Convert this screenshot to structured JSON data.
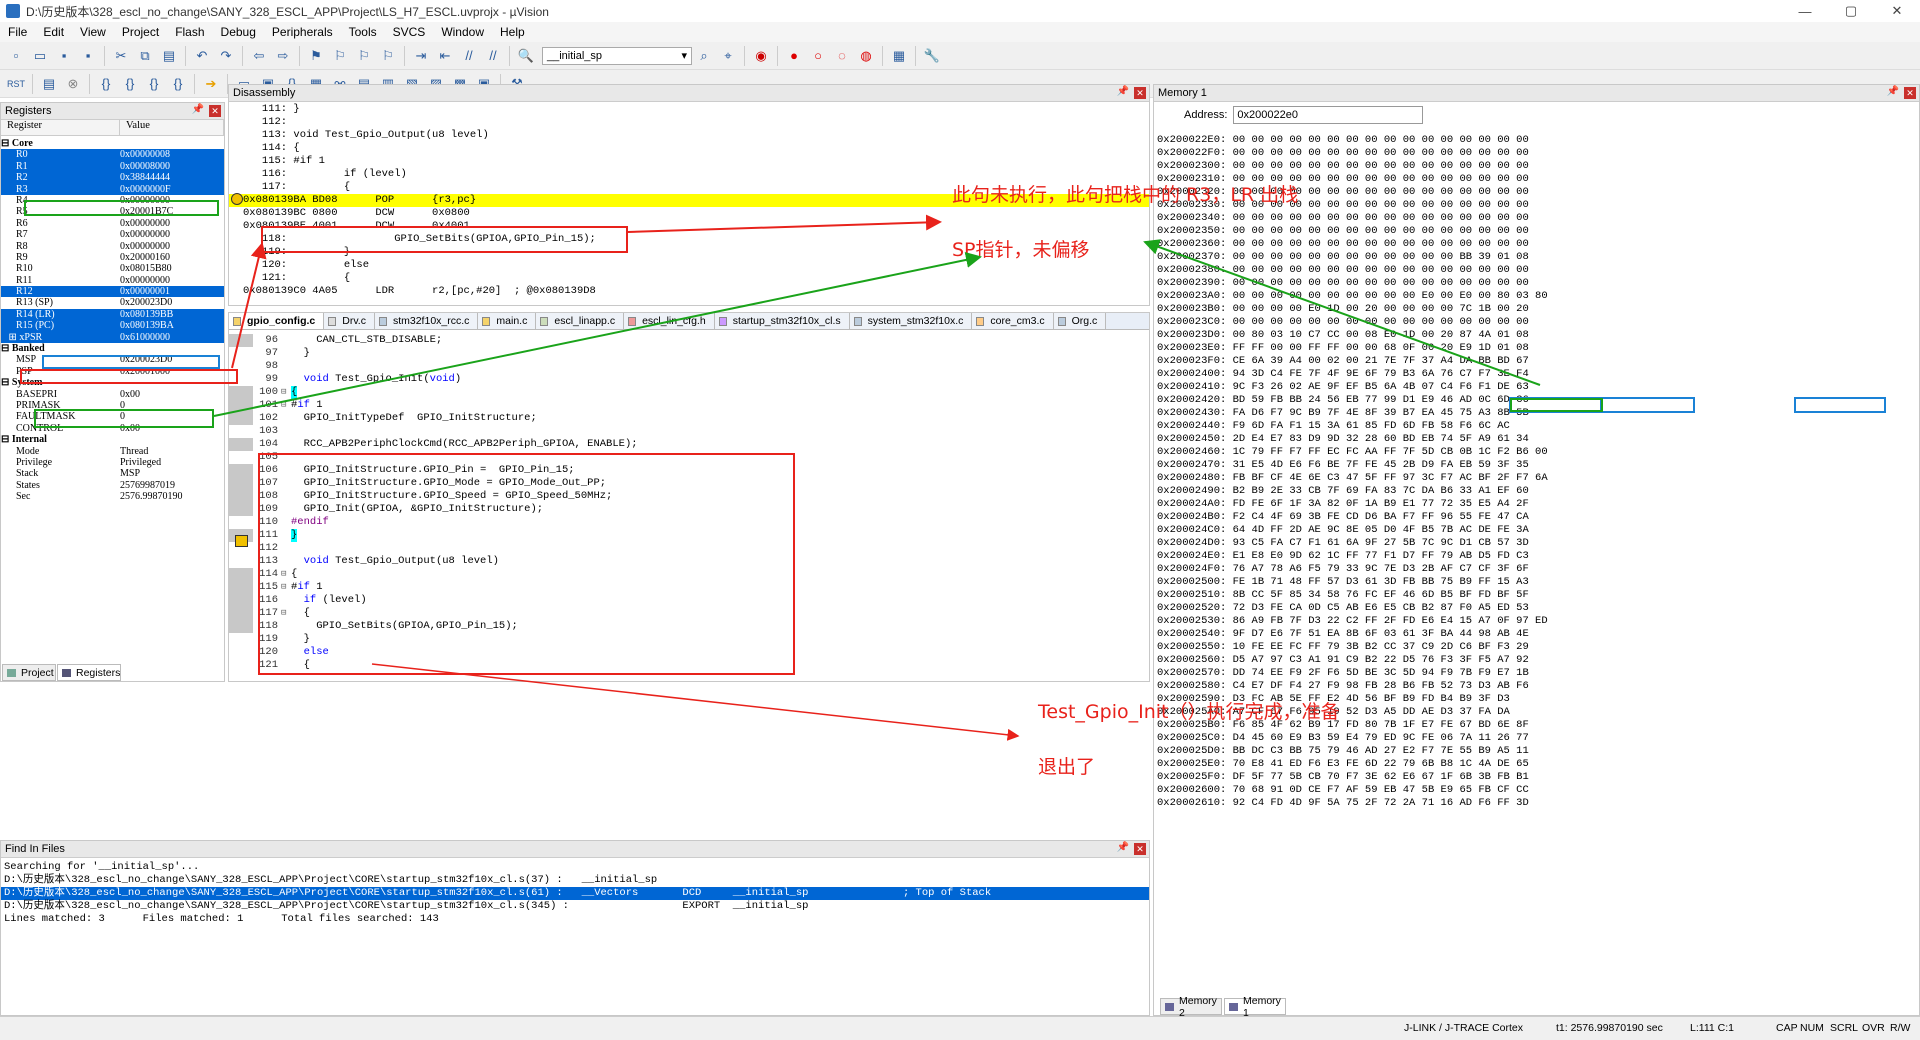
{
  "title": "D:\\历史版本\\328_escl_no_change\\SANY_328_ESCL_APP\\Project\\LS_H7_ESCL.uvprojx - µVision",
  "window_controls": {
    "min": "—",
    "max": "▢",
    "close": "✕"
  },
  "menu": [
    "File",
    "Edit",
    "View",
    "Project",
    "Flash",
    "Debug",
    "Peripherals",
    "Tools",
    "SVCS",
    "Window",
    "Help"
  ],
  "toolbar": {
    "search_combo": "__initial_sp"
  },
  "registers": {
    "title": "Registers",
    "col_register": "Register",
    "col_value": "Value",
    "rows": [
      {
        "name": "⊟ Core",
        "value": "",
        "group": true
      },
      {
        "name": "      R0",
        "value": "0x00000008",
        "sel": true
      },
      {
        "name": "      R1",
        "value": "0x00008000",
        "sel": true
      },
      {
        "name": "      R2",
        "value": "0x38844444",
        "sel": true
      },
      {
        "name": "      R3",
        "value": "0x0000000F",
        "sel": true
      },
      {
        "name": "      R4",
        "value": "0x00000000"
      },
      {
        "name": "      R5",
        "value": "0x20001B7C"
      },
      {
        "name": "      R6",
        "value": "0x00000000"
      },
      {
        "name": "      R7",
        "value": "0x00000000"
      },
      {
        "name": "      R8",
        "value": "0x00000000"
      },
      {
        "name": "      R9",
        "value": "0x20000160"
      },
      {
        "name": "      R10",
        "value": "0x08015B80"
      },
      {
        "name": "      R11",
        "value": "0x00000000"
      },
      {
        "name": "      R12",
        "value": "0x00000001",
        "sel": true
      },
      {
        "name": "      R13 (SP)",
        "value": "0x200023D0"
      },
      {
        "name": "      R14 (LR)",
        "value": "0x080139BB",
        "sel": true
      },
      {
        "name": "      R15 (PC)",
        "value": "0x080139BA",
        "sel": true
      },
      {
        "name": "   ⊞ xPSR",
        "value": "0x61000000",
        "sel": true
      },
      {
        "name": "⊟ Banked",
        "value": "",
        "group": true
      },
      {
        "name": "      MSP",
        "value": "0x200023D0"
      },
      {
        "name": "      PSP",
        "value": "0x20001000"
      },
      {
        "name": "⊟ System",
        "value": "",
        "group": true
      },
      {
        "name": "      BASEPRI",
        "value": "0x00"
      },
      {
        "name": "      PRIMASK",
        "value": "0"
      },
      {
        "name": "      FAULTMASK",
        "value": "0"
      },
      {
        "name": "      CONTROL",
        "value": "0x00"
      },
      {
        "name": "⊟ Internal",
        "value": "",
        "group": true
      },
      {
        "name": "      Mode",
        "value": "Thread"
      },
      {
        "name": "      Privilege",
        "value": "Privileged"
      },
      {
        "name": "      Stack",
        "value": "MSP"
      },
      {
        "name": "      States",
        "value": "25769987019"
      },
      {
        "name": "      Sec",
        "value": "2576.99870190"
      }
    ],
    "tabs": [
      "Project",
      "Registers"
    ]
  },
  "disassembly": {
    "title": "Disassembly",
    "lines": [
      "   111: }",
      "   112:",
      "   113: void Test_Gpio_Output(u8 level)",
      "   114: {",
      "   115: #if 1",
      "   116:         if (level)",
      "   117:         {",
      "0x080139BA BD08      POP      {r3,pc}",
      "0x080139BC 0800      DCW      0x0800",
      "0x080139BE 4001      DCW      0x4001",
      "   118:                 GPIO_SetBits(GPIOA,GPIO_Pin_15);",
      "   119:         }",
      "   120:         else",
      "   121:         {",
      "0x080139C0 4A05      LDR      r2,[pc,#20]  ; @0x080139D8"
    ]
  },
  "editor": {
    "tabs": [
      "gpio_config.c",
      "Drv.c",
      "stm32f10x_rcc.c",
      "main.c",
      "escl_linapp.c",
      "escl_lin_cfg.h",
      "startup_stm32f10x_cl.s",
      "system_stm32f10x.c",
      "core_cm3.c",
      "Org.c"
    ],
    "lines": [
      {
        "n": "96",
        "g": true,
        "f": "",
        "src": "    CAN_CTL_STB_DISABLE;"
      },
      {
        "n": "97",
        "g": false,
        "f": "",
        "src": "  }"
      },
      {
        "n": "98",
        "g": false,
        "f": "",
        "src": ""
      },
      {
        "n": "99",
        "g": false,
        "f": "",
        "src": "  void Test_Gpio_Init(void)"
      },
      {
        "n": "100",
        "g": true,
        "f": "⊟",
        "src": "{"
      },
      {
        "n": "101",
        "g": true,
        "f": "⊟",
        "src": "#if 1"
      },
      {
        "n": "102",
        "g": true,
        "f": "",
        "src": "  GPIO_InitTypeDef  GPIO_InitStructure;"
      },
      {
        "n": "103",
        "g": false,
        "f": "",
        "src": ""
      },
      {
        "n": "104",
        "g": true,
        "f": "",
        "src": "  RCC_APB2PeriphClockCmd(RCC_APB2Periph_GPIOA, ENABLE);"
      },
      {
        "n": "105",
        "g": false,
        "f": "",
        "src": ""
      },
      {
        "n": "106",
        "g": true,
        "f": "",
        "src": "  GPIO_InitStructure.GPIO_Pin =  GPIO_Pin_15;"
      },
      {
        "n": "107",
        "g": true,
        "f": "",
        "src": "  GPIO_InitStructure.GPIO_Mode = GPIO_Mode_Out_PP;"
      },
      {
        "n": "108",
        "g": true,
        "f": "",
        "src": "  GPIO_InitStructure.GPIO_Speed = GPIO_Speed_50MHz;"
      },
      {
        "n": "109",
        "g": true,
        "f": "",
        "src": "  GPIO_Init(GPIOA, &GPIO_InitStructure);"
      },
      {
        "n": "110",
        "g": false,
        "f": "",
        "src": "#endif"
      },
      {
        "n": "111",
        "g": true,
        "f": "",
        "src": "}"
      },
      {
        "n": "112",
        "g": false,
        "f": "",
        "src": ""
      },
      {
        "n": "113",
        "g": false,
        "f": "",
        "src": "  void Test_Gpio_Output(u8 level)"
      },
      {
        "n": "114",
        "g": true,
        "f": "⊟",
        "src": "{"
      },
      {
        "n": "115",
        "g": true,
        "f": "⊟",
        "src": "#if 1"
      },
      {
        "n": "116",
        "g": true,
        "f": "",
        "src": "  if (level)"
      },
      {
        "n": "117",
        "g": true,
        "f": "⊟",
        "src": "  {"
      },
      {
        "n": "118",
        "g": true,
        "f": "",
        "src": "    GPIO_SetBits(GPIOA,GPIO_Pin_15);"
      },
      {
        "n": "119",
        "g": false,
        "f": "",
        "src": "  }"
      },
      {
        "n": "120",
        "g": false,
        "f": "",
        "src": "  else"
      },
      {
        "n": "121",
        "g": false,
        "f": "",
        "src": "  {"
      }
    ]
  },
  "memory": {
    "title": "Memory 1",
    "address_label": "Address:",
    "address_value": "0x200022e0",
    "rows": [
      "0x200022E0: 00 00 00 00 00 00 00 00 00 00 00 00 00 00 00 00",
      "0x200022F0: 00 00 00 00 00 00 00 00 00 00 00 00 00 00 00 00",
      "0x20002300: 00 00 00 00 00 00 00 00 00 00 00 00 00 00 00 00",
      "0x20002310: 00 00 00 00 00 00 00 00 00 00 00 00 00 00 00 00",
      "0x20002320: 00 00 00 00 00 00 00 00 00 00 00 00 00 00 00 00",
      "0x20002330: 00 00 00 00 00 00 00 00 00 00 00 00 00 00 00 00",
      "0x20002340: 00 00 00 00 00 00 00 00 00 00 00 00 00 00 00 00",
      "0x20002350: 00 00 00 00 00 00 00 00 00 00 00 00 00 00 00 00",
      "0x20002360: 00 00 00 00 00 00 00 00 00 00 00 00 00 00 00 00",
      "0x20002370: 00 00 00 00 00 00 00 00 00 00 00 00 BB 39 01 08",
      "0x20002380: 00 00 00 00 00 00 00 00 00 00 00 00 00 00 00 00",
      "0x20002390: 00 00 00 00 00 00 00 00 00 00 00 00 00 00 00 00",
      "0x200023A0: 00 00 00 00 00 00 00 00 00 00 E0 00 E0 00 80 03 80",
      "0x200023B0: 00 00 00 00 E0 1D 00 20 00 00 00 00 7C 1B 00 20",
      "0x200023C0: 00 00 00 00 00 00 00 00 00 00 00 00 00 00 00 00",
      "0x200023D0: 00 80 03 10 C7 CC 00 08 E0 1D 00 20 87 4A 01 08",
      "0x200023E0: FF FF 00 00 FF FF 00 00 68 0F 00 20 E9 1D 01 08",
      "0x200023F0: CE 6A 39 A4 00 02 00 21 7E 7F 37 A4 DA BB BD 67",
      "0x20002400: 94 3D C4 FE 7F 4F 9E 6F 79 B3 6A 76 C7 F7 3E F4",
      "0x20002410: 9C F3 26 02 AE 9F EF B5 6A 4B 07 C4 F6 F1 DE 63",
      "0x20002420: BD 59 FB BB 24 56 EB 77 99 D1 E9 46 AD 0C 6D C6",
      "0x20002430: FA D6 F7 9C B9 7F 4E 8F 39 B7 EA 45 75 A3 8B 5B",
      "0x20002440: F9 6D FA F1 15 3A 61 85 FD 6D FB 58 F6 6C AC",
      "0x20002450: 2D E4 E7 83 D9 9D 32 28 60 BD EB 74 5F A9 61 34",
      "0x20002460: 1C 79 FF F7 FF EC FC AA FF 7F 5D CB 0B 1C F2 B6 00",
      "0x20002470: 31 E5 4D E6 F6 BE 7F FE 45 2B D9 FA EB 59 3F 35",
      "0x20002480: FB BF CF 4E 6E C3 47 5F FF 97 3C F7 AC BF 2F F7 6A",
      "0x20002490: B2 B9 2E 33 CB 7F 69 FA 83 7C DA B6 33 A1 EF 60",
      "0x200024A0: FD FE 6F 1F 3A 82 0F 1A B9 E1 77 72 35 E5 A4 2F",
      "0x200024B0: F2 C4 4F 69 3B FE CD D6 BA F7 FF 96 55 FE 47 CA",
      "0x200024C0: 64 4D FF 2D AE 9C 8E 05 D0 4F B5 7B AC DE FE 3A",
      "0x200024D0: 93 C5 FA C7 F1 61 6A 9F 27 5B 7C 9C D1 CB 57 3D",
      "0x200024E0: E1 E8 E0 9D 62 1C FF 77 F1 D7 FF 79 AB D5 FD C3",
      "0x200024F0: 76 A7 78 A6 F5 79 33 9C 7E D3 2B AF C7 CF 3F 6F",
      "0x20002500: FE 1B 71 48 FF 57 D3 61 3D FB BB 75 B9 FF 15 A3",
      "0x20002510: 8B CC 5F 85 34 58 76 FC EF 46 6D B5 BF FD BF 5F",
      "0x20002520: 72 D3 FE CA 0D C5 AB E6 E5 CB B2 87 F0 A5 ED 53",
      "0x20002530: 86 A9 FB 7F D3 22 C2 FF 2F FD E6 E4 15 A7 0F 97 ED",
      "0x20002540: 9F D7 E6 7F 51 EA 8B 6F 03 61 3F BA 44 98 AB 4E",
      "0x20002550: 10 FE EE FC FF 79 3B B2 CC 37 C9 2D C6 BF F3 29",
      "0x20002560: D5 A7 97 C3 A1 91 C9 B2 22 D5 76 F3 3F F5 A7 92",
      "0x20002570: DD 74 EE F9 2F F6 5D BE 3C 5D 94 F9 7B F9 E7 1B",
      "0x20002580: C4 E7 DF F4 27 F9 98 FB 28 B6 FB 52 73 D3 AB F6",
      "0x20002590: D3 FC AB 5E FF E2 4D 56 BF B9 FD B4 B9 3F D3",
      "0x200025A0: A7 CF 67 F6 95 19 52 D3 A5 DD AE D3 37 FA DA",
      "0x200025B0: F6 85 4F 62 B9 17 FD 80 7B 1F E7 FE 67 BD 6E 8F",
      "0x200025C0: D4 45 60 E9 B3 59 E4 79 ED 9C FE 06 7A 11 26 77",
      "0x200025D0: BB DC C3 BB 75 79 46 AD 27 E2 F7 7E 55 B9 A5 11",
      "0x200025E0: 70 E8 41 ED F6 E3 FE 6D 22 79 6B B8 1C 4A DE 65",
      "0x200025F0: DF 5F 77 5B CB 70 F7 3E 62 E6 67 1F 6B 3B FB B1",
      "0x20002600: 70 68 91 0D CE F7 AF 59 EB 47 5B E9 65 FB CF CC",
      "0x20002610: 92 C4 FD 4D 9F 5A 75 2F 72 2A 71 16 AD F6 FF 3D"
    ],
    "tabs": [
      "Memory 2",
      "Memory 1"
    ]
  },
  "find": {
    "title": "Find In Files",
    "lines": [
      "Searching for '__initial_sp'...",
      "D:\\历史版本\\328_escl_no_change\\SANY_328_ESCL_APP\\Project\\CORE\\startup_stm32f10x_cl.s(37) :   __initial_sp",
      "D:\\历史版本\\328_escl_no_change\\SANY_328_ESCL_APP\\Project\\CORE\\startup_stm32f10x_cl.s(61) :   __Vectors       DCD     __initial_sp               ; Top of Stack",
      "D:\\历史版本\\328_escl_no_change\\SANY_328_ESCL_APP\\Project\\CORE\\startup_stm32f10x_cl.s(345) :                  EXPORT  __initial_sp",
      "Lines matched: 3      Files matched: 1      Total files searched: 143"
    ]
  },
  "status": {
    "debugger": "J-LINK / J-TRACE Cortex",
    "time": "t1: 2576.99870190 sec",
    "pos": "L:111 C:1",
    "caps": "CAP",
    "num": "NUM",
    "scrl": "SCRL",
    "ovr": "OVR",
    "rw": "R/W"
  },
  "annotations": {
    "a1": "此句未执行，此句把栈中的 R3，LR 出栈",
    "a2": "SP指针，未偏移",
    "a3": "Test_Gpio_Init（）执行完成，准备",
    "a4": "退出了"
  },
  "colors": {
    "selection": "#0066d4",
    "highlight": "#ffff00",
    "annot_red": "#e8221b",
    "annot_green": "#1aa31a",
    "annot_blue": "#1a82d6"
  }
}
